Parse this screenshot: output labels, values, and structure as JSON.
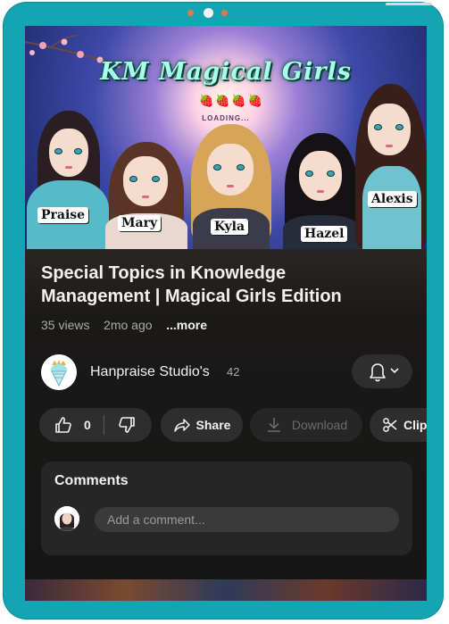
{
  "video": {
    "banner_title": "KM Magical Girls",
    "banner_loading": "LOADING...",
    "characters": [
      "Praise",
      "Mary",
      "Kyla",
      "Hazel",
      "Alexis"
    ],
    "title": "Special Topics in Knowledge Management | Magical Girls Edition",
    "views": "35 views",
    "age": "2mo ago",
    "more_label": "...more"
  },
  "channel": {
    "name": "Hanpraise Studio's",
    "subscribers": "42",
    "avatar_icon": "ice-cream-crown-icon"
  },
  "actions": {
    "like_count": "0",
    "share_label": "Share",
    "download_label": "Download",
    "clip_label": "Clip"
  },
  "comments": {
    "title": "Comments",
    "placeholder": "Add a comment..."
  },
  "colors": {
    "frame": "#13a6b2",
    "background": "#161616",
    "chip": "#2e2e2e"
  }
}
